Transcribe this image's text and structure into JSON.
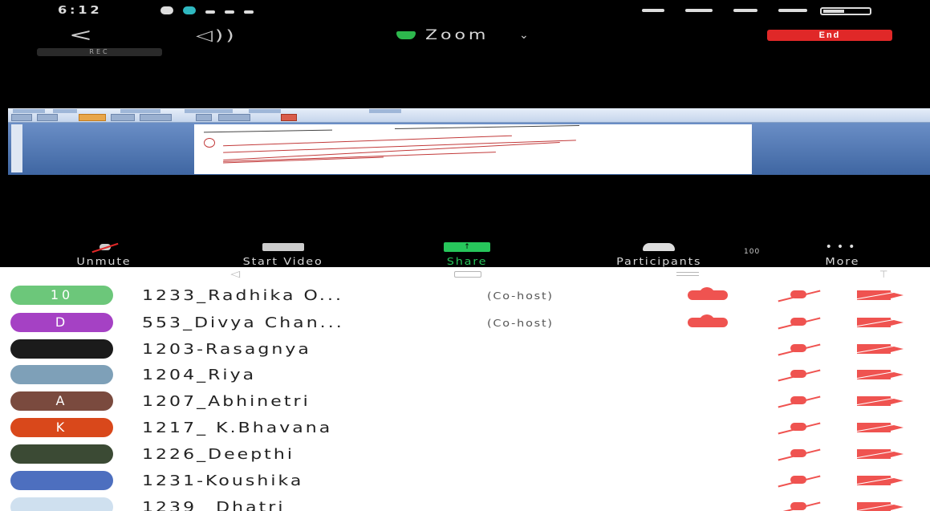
{
  "status_bar": {
    "time": "6:12"
  },
  "meeting": {
    "title": "Zoom",
    "end_label": "End",
    "rec_label": "REC",
    "controls": [
      {
        "label": "Unmute",
        "icon": "mic-muted-icon"
      },
      {
        "label": "Start Video",
        "icon": "video-off-icon"
      },
      {
        "label": "Share",
        "icon": "share-icon"
      },
      {
        "label": "Participants",
        "icon": "participants-icon"
      },
      {
        "label": "More",
        "icon": "more-icon"
      }
    ],
    "participant_count": "100"
  },
  "participants": [
    {
      "name": "1233_Radhika O...",
      "role": "(Co-host)",
      "avatar_text": "10",
      "avatar_color": "#6cc77a",
      "cloud": true
    },
    {
      "name": "553_Divya Chan...",
      "role": "(Co-host)",
      "avatar_text": "D",
      "avatar_color": "#a541c4",
      "cloud": true
    },
    {
      "name": "1203-Rasagnya",
      "role": "",
      "avatar_text": "",
      "avatar_color": "#1b1b1b",
      "cloud": false
    },
    {
      "name": "1204_Riya",
      "role": "",
      "avatar_text": "",
      "avatar_color": "#7ea0b8",
      "cloud": false
    },
    {
      "name": "1207_Abhinetri",
      "role": "",
      "avatar_text": "A",
      "avatar_color": "#7a4a3e",
      "cloud": false
    },
    {
      "name": "1217_ K.Bhavana",
      "role": "",
      "avatar_text": "K",
      "avatar_color": "#d9481b",
      "cloud": false
    },
    {
      "name": "1226_Deepthi",
      "role": "",
      "avatar_text": "",
      "avatar_color": "#3b4a34",
      "cloud": false
    },
    {
      "name": "1231-Koushika",
      "role": "",
      "avatar_text": "",
      "avatar_color": "#4d6fbf",
      "cloud": false
    },
    {
      "name": "1239_ Dhatri",
      "role": "",
      "avatar_text": "",
      "avatar_color": "#cfe0ef",
      "cloud": false
    }
  ]
}
